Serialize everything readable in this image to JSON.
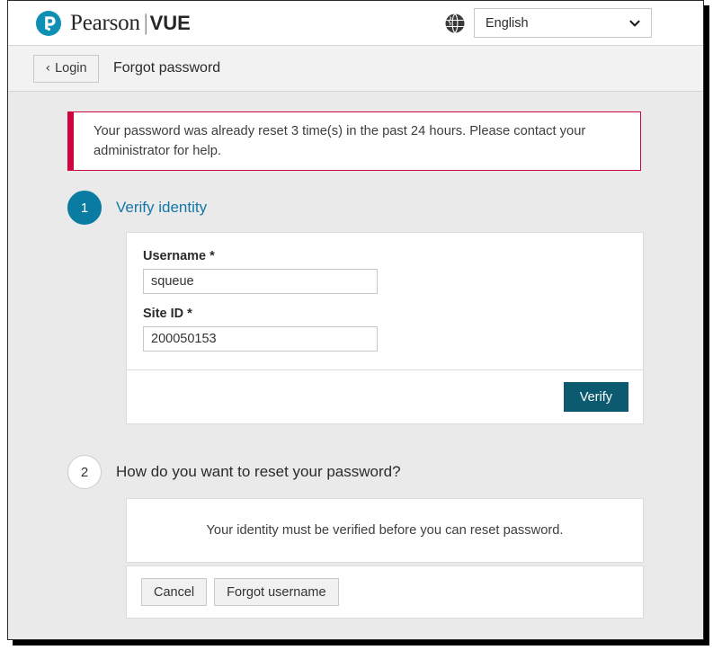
{
  "header": {
    "brand_name": "Pearson",
    "brand_separator": "|",
    "brand_product": "VUE",
    "globe_icon": "globe-icon",
    "language": {
      "selected": "English",
      "caret_icon": "chevron-down-icon"
    }
  },
  "breadcrumb": {
    "back_icon": "chevron-left-icon",
    "back_label": "Login",
    "title": "Forgot password"
  },
  "alert": {
    "message": "Your password was already reset 3 time(s) in the past 24 hours. Please contact your administrator for help.",
    "accent_color": "#d0043c"
  },
  "steps": [
    {
      "number": "1",
      "label": "Verify identity",
      "state": "active",
      "accent_color": "#0a7ba1"
    },
    {
      "number": "2",
      "label": "How do you want to reset your password?",
      "state": "inactive"
    }
  ],
  "verify_form": {
    "username": {
      "label": "Username *",
      "value": "squeue",
      "placeholder": ""
    },
    "site_id": {
      "label": "Site ID *",
      "value": "200050153",
      "placeholder": ""
    },
    "submit_label": "Verify",
    "submit_color": "#0b5a70"
  },
  "reset_panel": {
    "message": "Your identity must be verified before you can reset password."
  },
  "actions": {
    "cancel_label": "Cancel",
    "forgot_username_label": "Forgot username"
  }
}
